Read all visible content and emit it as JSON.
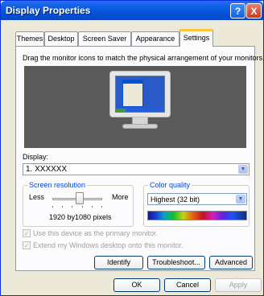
{
  "window": {
    "title": "Display Properties",
    "help_glyph": "?",
    "close_glyph": "X"
  },
  "tabs": [
    {
      "label": "Themes"
    },
    {
      "label": "Desktop"
    },
    {
      "label": "Screen Saver"
    },
    {
      "label": "Appearance"
    },
    {
      "label": "Settings",
      "active": true
    }
  ],
  "settings": {
    "instruction": "Drag the monitor icons to match the physical arrangement of your monitors.",
    "display_label": "Display:",
    "display_value": "1. XXXXXX",
    "resolution": {
      "group_title": "Screen resolution",
      "less_label": "Less",
      "more_label": "More",
      "value_text": "1920 by1080 pixels",
      "slider_level_fraction": 0.55
    },
    "color_quality": {
      "group_title": "Color quality",
      "selected": "Highest (32 bit)"
    },
    "checkbox_primary": {
      "label": "Use this device as the primary monitor.",
      "checked": true,
      "enabled": false
    },
    "checkbox_extend": {
      "label": "Extend my Windows desktop onto this monitor.",
      "checked": true,
      "enabled": false
    },
    "identify_label": "Identify",
    "troubleshoot_label": "Troubleshoot...",
    "advanced_label": "Advanced"
  },
  "footer": {
    "ok_label": "OK",
    "cancel_label": "Cancel",
    "apply_label": "Apply"
  },
  "colors": {
    "titlebar": "#0450d6",
    "dialog_bg": "#ece9d8",
    "tab_highlight": "#ffc83c",
    "group_title": "#0046d5"
  }
}
